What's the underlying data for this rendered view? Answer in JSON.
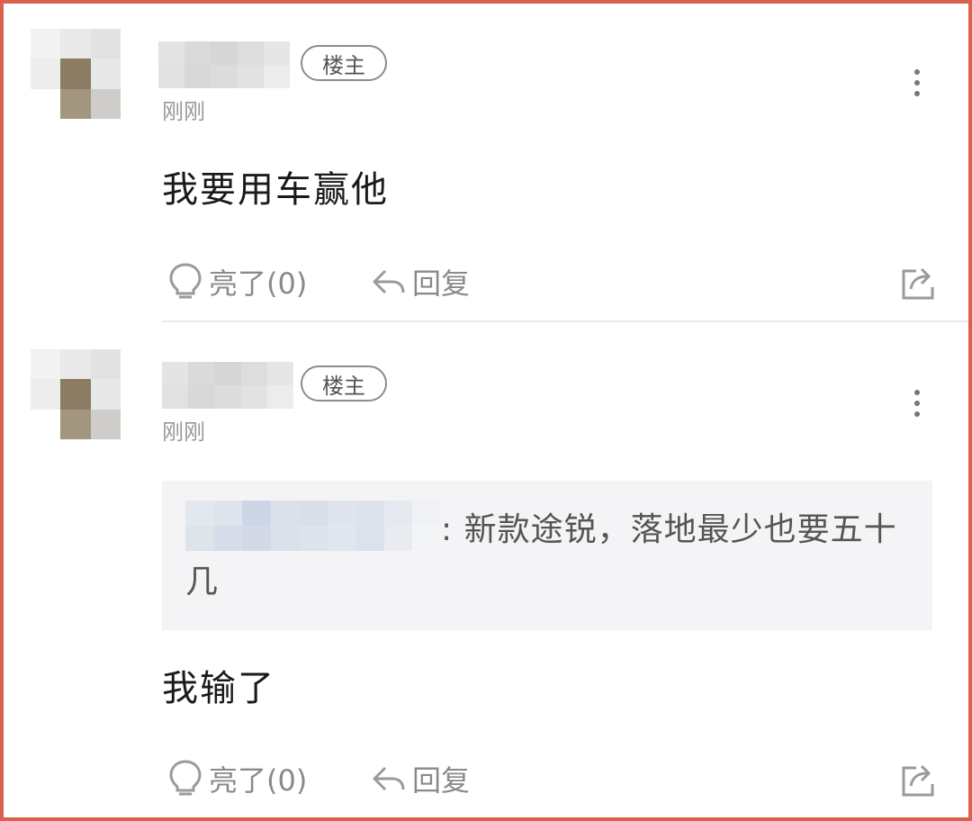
{
  "comments": [
    {
      "badge": "楼主",
      "time": "刚刚",
      "text": "我要用车赢他",
      "quote": null,
      "actions": {
        "like": "亮了(0)",
        "reply": "回复"
      }
    },
    {
      "badge": "楼主",
      "time": "刚刚",
      "text": "我输了",
      "quote": {
        "text": ": 新款途锐，落地最少也要五十几"
      },
      "actions": {
        "like": "亮了(0)",
        "reply": "回复"
      }
    }
  ],
  "colors": {
    "frame": "#d9614e",
    "muted": "#8a8a8a",
    "quote_bg": "#f4f4f6"
  },
  "icons": [
    "more-vertical-icon",
    "lightbulb-icon",
    "reply-arrow-icon",
    "share-icon"
  ]
}
